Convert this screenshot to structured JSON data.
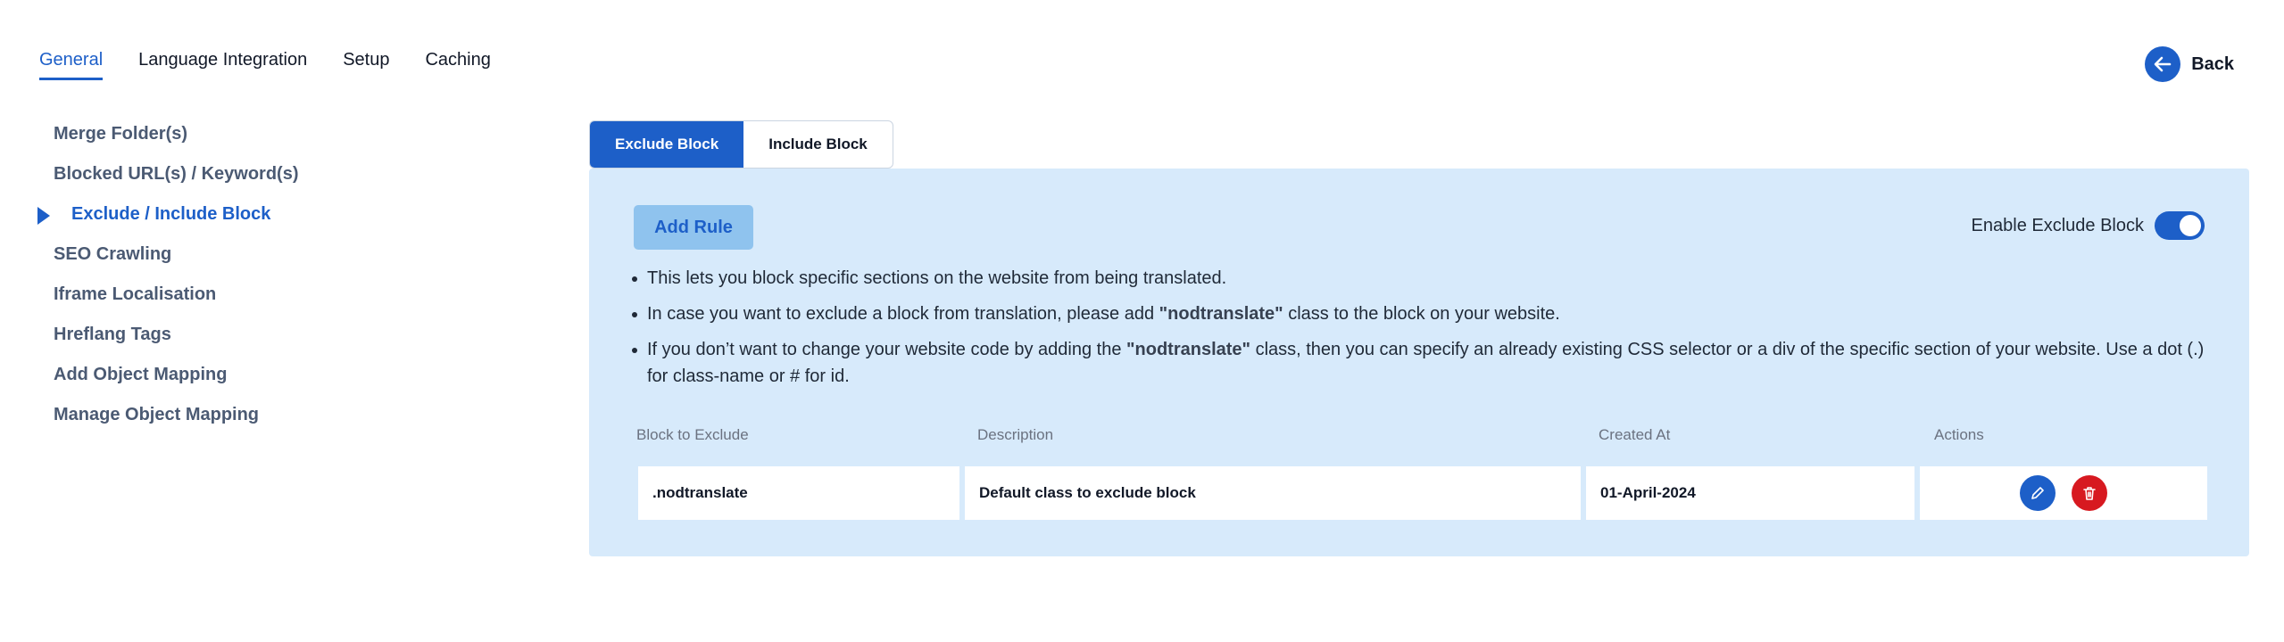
{
  "top_tabs": [
    {
      "label": "General",
      "active": true
    },
    {
      "label": "Language Integration",
      "active": false
    },
    {
      "label": "Setup",
      "active": false
    },
    {
      "label": "Caching",
      "active": false
    }
  ],
  "back": {
    "label": "Back",
    "icon": "arrow-left-icon"
  },
  "sidebar": {
    "items": [
      {
        "label": "Merge Folder(s)"
      },
      {
        "label": "Blocked URL(s) / Keyword(s)"
      },
      {
        "label": "Exclude / Include Block",
        "active": true
      },
      {
        "label": "SEO Crawling"
      },
      {
        "label": "Iframe Localisation"
      },
      {
        "label": "Hreflang Tags"
      },
      {
        "label": "Add Object Mapping"
      },
      {
        "label": "Manage Object Mapping"
      }
    ]
  },
  "sub_tabs": [
    {
      "label": "Exclude Block",
      "active": true
    },
    {
      "label": "Include Block",
      "active": false
    }
  ],
  "panel": {
    "add_rule_label": "Add Rule",
    "enable_label": "Enable Exclude Block",
    "enable_on": true,
    "bullets": [
      {
        "pre": "This lets you block specific sections on the website from being translated.",
        "code": "",
        "post": ""
      },
      {
        "pre": "In case you want to exclude a block from translation, please add ",
        "code": "\"nodtranslate\"",
        "post": " class to the block on your website."
      },
      {
        "pre": "If you don’t want to change your website code by adding the ",
        "code": "\"nodtranslate\"",
        "post": " class, then you can specify an already existing CSS selector or a div of the specific section of your website. Use a dot (.) for class-name or # for id."
      }
    ]
  },
  "table": {
    "headers": [
      "Block to Exclude",
      "Description",
      "Created At",
      "Actions"
    ],
    "rows": [
      {
        "block": ".nodtranslate",
        "description": "Default class to exclude block",
        "created_at": "01-April-2024"
      }
    ]
  },
  "colors": {
    "accent": "#1d5fc8",
    "panel_bg": "#d7eafb",
    "delete": "#d71920"
  }
}
